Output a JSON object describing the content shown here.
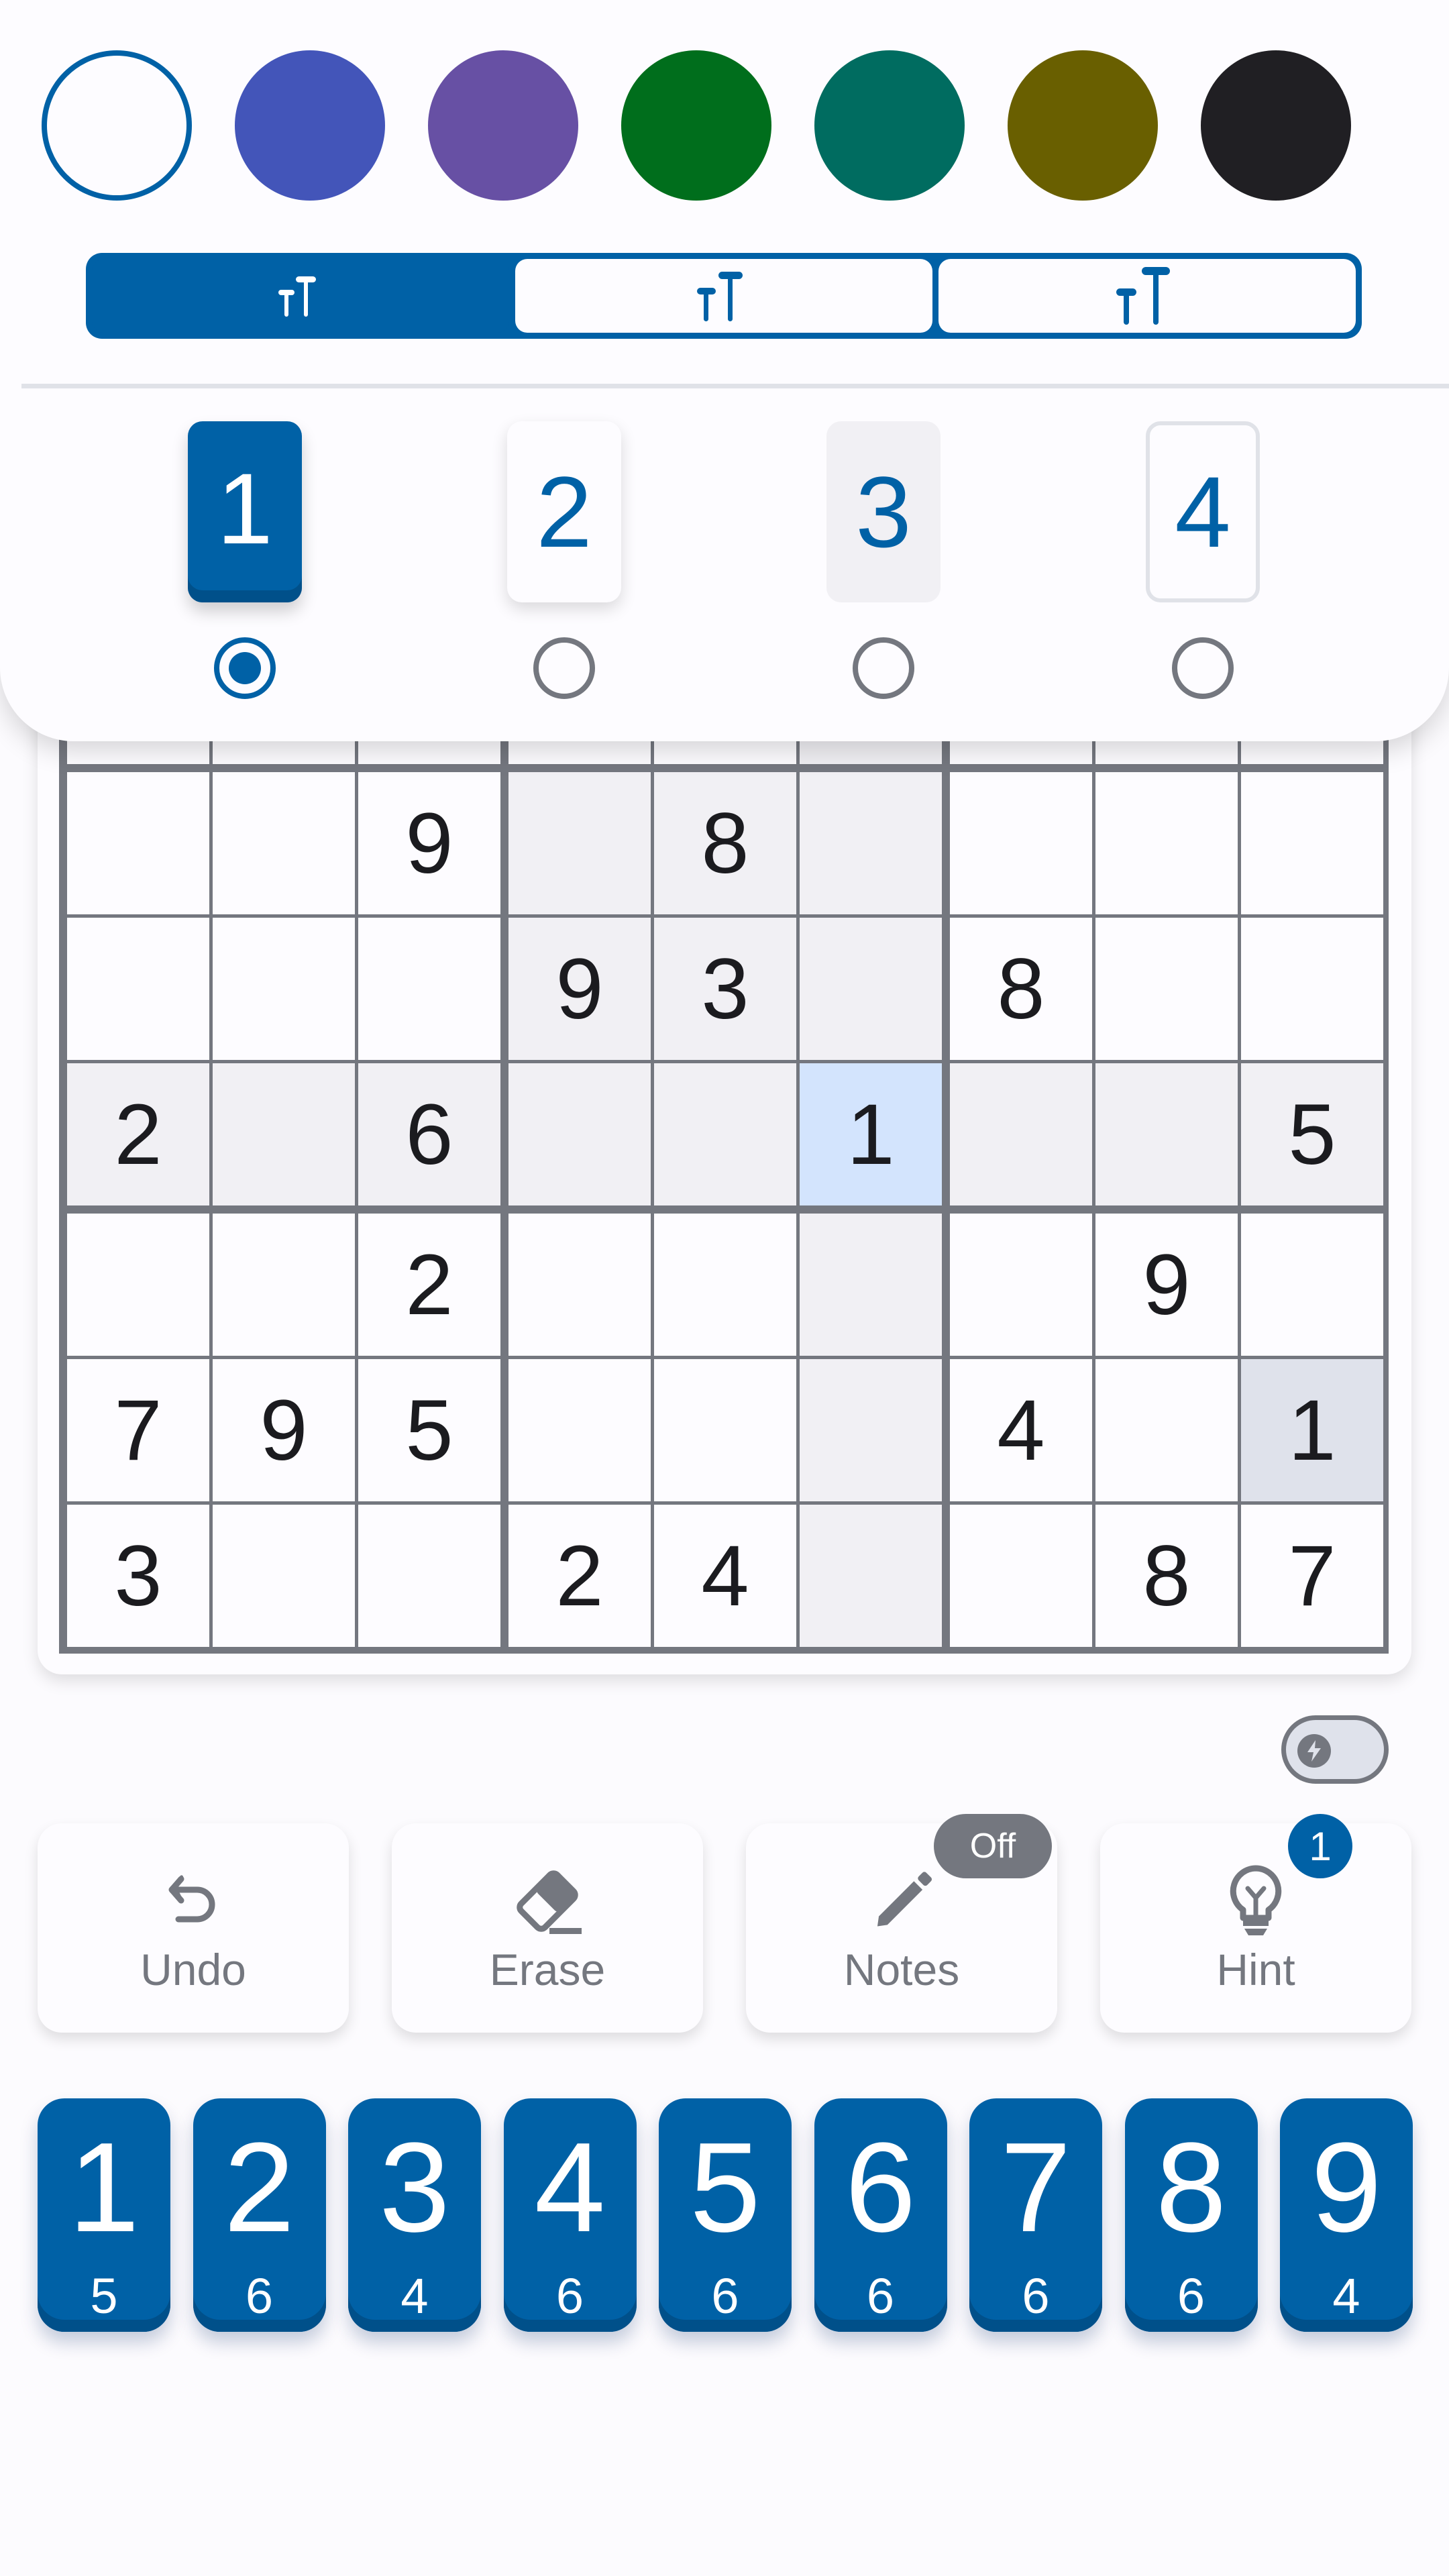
{
  "colors": {
    "accent": "#0061a6",
    "accent_dark": "#00508a",
    "outline": "#74777f",
    "text": "#1b1b1f"
  },
  "color_swatches": [
    {
      "name": "default",
      "hex": "#fdfcff",
      "selected": true
    },
    {
      "name": "indigo",
      "hex": "#4355b9",
      "selected": false
    },
    {
      "name": "purple",
      "hex": "#6750a4",
      "selected": false
    },
    {
      "name": "green",
      "hex": "#006e1c",
      "selected": false
    },
    {
      "name": "teal",
      "hex": "#006c60",
      "selected": false
    },
    {
      "name": "olive",
      "hex": "#695f00",
      "selected": false
    },
    {
      "name": "black",
      "hex": "#201f23",
      "selected": false
    }
  ],
  "font_sizes": {
    "options": [
      "small",
      "medium",
      "large"
    ],
    "selected": "small"
  },
  "number_styles": [
    {
      "label": "1",
      "selected": true
    },
    {
      "label": "2",
      "selected": false
    },
    {
      "label": "3",
      "selected": false
    },
    {
      "label": "4",
      "selected": false
    }
  ],
  "board": {
    "rows": [
      [
        "",
        "",
        "",
        "",
        "",
        "",
        "",
        "",
        ""
      ],
      [
        "",
        "",
        "",
        "",
        "",
        "",
        "",
        "",
        ""
      ],
      [
        "",
        "",
        "",
        "",
        "",
        "",
        "",
        "",
        ""
      ],
      [
        "",
        "",
        "9",
        "",
        "8",
        "",
        "",
        "",
        ""
      ],
      [
        "",
        "",
        "",
        "9",
        "3",
        "",
        "8",
        "",
        ""
      ],
      [
        "2",
        "",
        "6",
        "",
        "",
        "1",
        "",
        "",
        "5"
      ],
      [
        "",
        "",
        "2",
        "",
        "",
        "",
        "",
        "9",
        ""
      ],
      [
        "7",
        "9",
        "5",
        "",
        "",
        "",
        "4",
        "",
        "1"
      ],
      [
        "3",
        "",
        "",
        "2",
        "4",
        "",
        "",
        "8",
        "7"
      ]
    ],
    "selected_cell": {
      "row": 5,
      "col": 5
    },
    "visible_from_row": 3
  },
  "toggle": {
    "name": "fast-mode",
    "state": "off"
  },
  "actions": {
    "undo_label": "Undo",
    "erase_label": "Erase",
    "notes_label": "Notes",
    "notes_badge": "Off",
    "hint_label": "Hint",
    "hint_badge": "1"
  },
  "numpad": [
    {
      "digit": "1",
      "remaining": "5"
    },
    {
      "digit": "2",
      "remaining": "6"
    },
    {
      "digit": "3",
      "remaining": "4"
    },
    {
      "digit": "4",
      "remaining": "6"
    },
    {
      "digit": "5",
      "remaining": "6"
    },
    {
      "digit": "6",
      "remaining": "6"
    },
    {
      "digit": "7",
      "remaining": "6"
    },
    {
      "digit": "8",
      "remaining": "6"
    },
    {
      "digit": "9",
      "remaining": "4"
    }
  ]
}
